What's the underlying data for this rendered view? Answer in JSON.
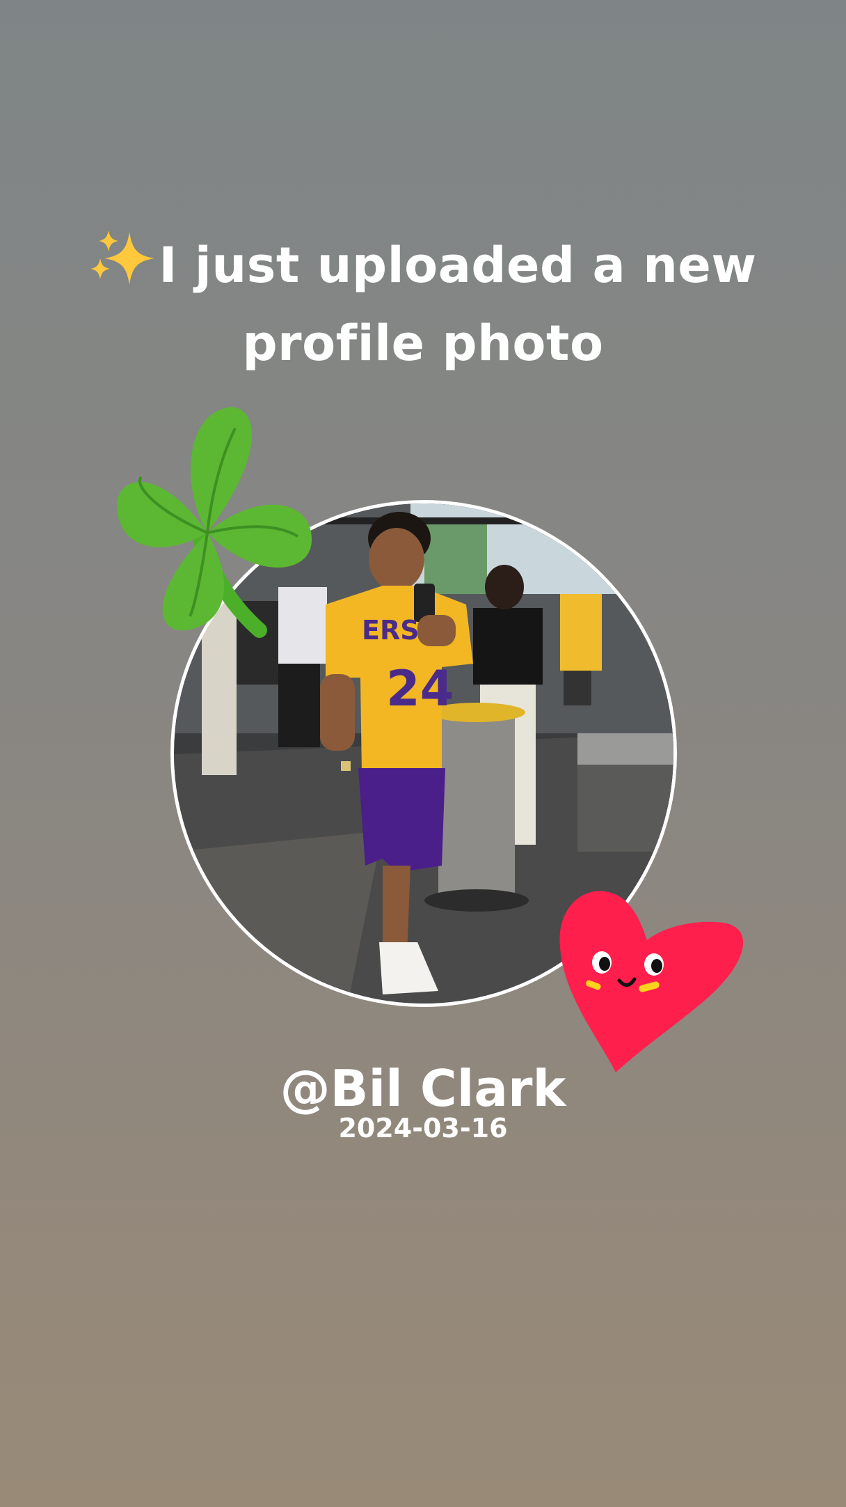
{
  "post": {
    "headline": "I just uploaded a new profile photo",
    "username": "@Bil Clark",
    "date": "2024-03-16"
  },
  "photo": {
    "jersey_number": "24",
    "jersey_text": "ERS"
  },
  "icons": {
    "sparkles": "sparkles-icon",
    "clover": "four-leaf-clover-sticker",
    "heart": "smiling-heart-sticker"
  },
  "colors": {
    "clover_green": "#4caf2a",
    "heart_red": "#ff1f4d",
    "jersey_yellow": "#f2b722",
    "shorts_purple": "#4a1f8a"
  }
}
